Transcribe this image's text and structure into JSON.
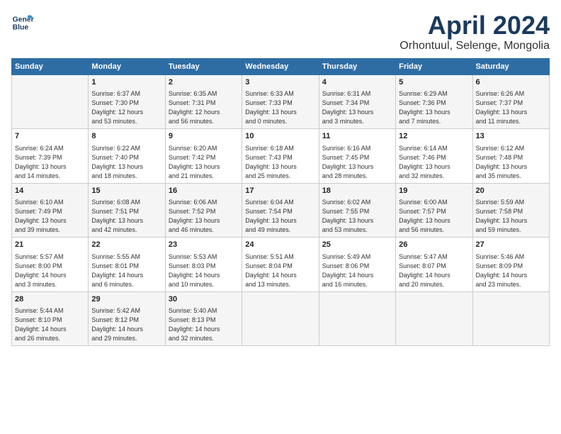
{
  "header": {
    "logo_line1": "General",
    "logo_line2": "Blue",
    "title": "April 2024",
    "subtitle": "Orhontuul, Selenge, Mongolia"
  },
  "days_of_week": [
    "Sunday",
    "Monday",
    "Tuesday",
    "Wednesday",
    "Thursday",
    "Friday",
    "Saturday"
  ],
  "weeks": [
    [
      {
        "day": "",
        "content": ""
      },
      {
        "day": "1",
        "content": "Sunrise: 6:37 AM\nSunset: 7:30 PM\nDaylight: 12 hours\nand 53 minutes."
      },
      {
        "day": "2",
        "content": "Sunrise: 6:35 AM\nSunset: 7:31 PM\nDaylight: 12 hours\nand 56 minutes."
      },
      {
        "day": "3",
        "content": "Sunrise: 6:33 AM\nSunset: 7:33 PM\nDaylight: 13 hours\nand 0 minutes."
      },
      {
        "day": "4",
        "content": "Sunrise: 6:31 AM\nSunset: 7:34 PM\nDaylight: 13 hours\nand 3 minutes."
      },
      {
        "day": "5",
        "content": "Sunrise: 6:29 AM\nSunset: 7:36 PM\nDaylight: 13 hours\nand 7 minutes."
      },
      {
        "day": "6",
        "content": "Sunrise: 6:26 AM\nSunset: 7:37 PM\nDaylight: 13 hours\nand 11 minutes."
      }
    ],
    [
      {
        "day": "7",
        "content": "Sunrise: 6:24 AM\nSunset: 7:39 PM\nDaylight: 13 hours\nand 14 minutes."
      },
      {
        "day": "8",
        "content": "Sunrise: 6:22 AM\nSunset: 7:40 PM\nDaylight: 13 hours\nand 18 minutes."
      },
      {
        "day": "9",
        "content": "Sunrise: 6:20 AM\nSunset: 7:42 PM\nDaylight: 13 hours\nand 21 minutes."
      },
      {
        "day": "10",
        "content": "Sunrise: 6:18 AM\nSunset: 7:43 PM\nDaylight: 13 hours\nand 25 minutes."
      },
      {
        "day": "11",
        "content": "Sunrise: 6:16 AM\nSunset: 7:45 PM\nDaylight: 13 hours\nand 28 minutes."
      },
      {
        "day": "12",
        "content": "Sunrise: 6:14 AM\nSunset: 7:46 PM\nDaylight: 13 hours\nand 32 minutes."
      },
      {
        "day": "13",
        "content": "Sunrise: 6:12 AM\nSunset: 7:48 PM\nDaylight: 13 hours\nand 35 minutes."
      }
    ],
    [
      {
        "day": "14",
        "content": "Sunrise: 6:10 AM\nSunset: 7:49 PM\nDaylight: 13 hours\nand 39 minutes."
      },
      {
        "day": "15",
        "content": "Sunrise: 6:08 AM\nSunset: 7:51 PM\nDaylight: 13 hours\nand 42 minutes."
      },
      {
        "day": "16",
        "content": "Sunrise: 6:06 AM\nSunset: 7:52 PM\nDaylight: 13 hours\nand 46 minutes."
      },
      {
        "day": "17",
        "content": "Sunrise: 6:04 AM\nSunset: 7:54 PM\nDaylight: 13 hours\nand 49 minutes."
      },
      {
        "day": "18",
        "content": "Sunrise: 6:02 AM\nSunset: 7:55 PM\nDaylight: 13 hours\nand 53 minutes."
      },
      {
        "day": "19",
        "content": "Sunrise: 6:00 AM\nSunset: 7:57 PM\nDaylight: 13 hours\nand 56 minutes."
      },
      {
        "day": "20",
        "content": "Sunrise: 5:59 AM\nSunset: 7:58 PM\nDaylight: 13 hours\nand 59 minutes."
      }
    ],
    [
      {
        "day": "21",
        "content": "Sunrise: 5:57 AM\nSunset: 8:00 PM\nDaylight: 14 hours\nand 3 minutes."
      },
      {
        "day": "22",
        "content": "Sunrise: 5:55 AM\nSunset: 8:01 PM\nDaylight: 14 hours\nand 6 minutes."
      },
      {
        "day": "23",
        "content": "Sunrise: 5:53 AM\nSunset: 8:03 PM\nDaylight: 14 hours\nand 10 minutes."
      },
      {
        "day": "24",
        "content": "Sunrise: 5:51 AM\nSunset: 8:04 PM\nDaylight: 14 hours\nand 13 minutes."
      },
      {
        "day": "25",
        "content": "Sunrise: 5:49 AM\nSunset: 8:06 PM\nDaylight: 14 hours\nand 16 minutes."
      },
      {
        "day": "26",
        "content": "Sunrise: 5:47 AM\nSunset: 8:07 PM\nDaylight: 14 hours\nand 20 minutes."
      },
      {
        "day": "27",
        "content": "Sunrise: 5:46 AM\nSunset: 8:09 PM\nDaylight: 14 hours\nand 23 minutes."
      }
    ],
    [
      {
        "day": "28",
        "content": "Sunrise: 5:44 AM\nSunset: 8:10 PM\nDaylight: 14 hours\nand 26 minutes."
      },
      {
        "day": "29",
        "content": "Sunrise: 5:42 AM\nSunset: 8:12 PM\nDaylight: 14 hours\nand 29 minutes."
      },
      {
        "day": "30",
        "content": "Sunrise: 5:40 AM\nSunset: 8:13 PM\nDaylight: 14 hours\nand 32 minutes."
      },
      {
        "day": "",
        "content": ""
      },
      {
        "day": "",
        "content": ""
      },
      {
        "day": "",
        "content": ""
      },
      {
        "day": "",
        "content": ""
      }
    ]
  ]
}
